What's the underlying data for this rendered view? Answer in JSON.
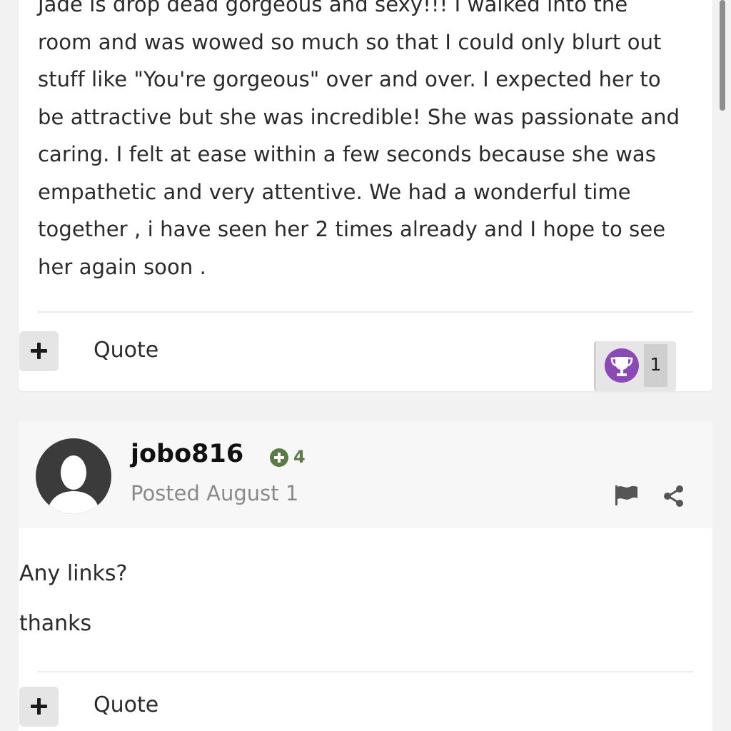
{
  "post1": {
    "lines": [
      "Jade is drop dead gorgeous and sexy!!! I walked into the",
      "room and was wowed so much so that I could only blurt out",
      "stuff like \"You're gorgeous\" over and over.  I expected her to",
      "be attractive but she was incredible! She was passionate and",
      "caring.  I felt at ease within a few seconds because she was",
      "empathetic and very attentive. We had a wonderful time",
      "together , i have seen her 2 times already and I hope to see",
      "her again soon ."
    ],
    "quote_label": "Quote",
    "reaction": {
      "icon": "trophy-icon",
      "count": "1",
      "color": "#8b49b8"
    }
  },
  "post2": {
    "author": "jobo816",
    "reputation": "4",
    "reputation_color": "#5b7a45",
    "posted": "Posted August 1",
    "body": [
      "Any links?",
      "thanks"
    ],
    "quote_label": "Quote"
  }
}
